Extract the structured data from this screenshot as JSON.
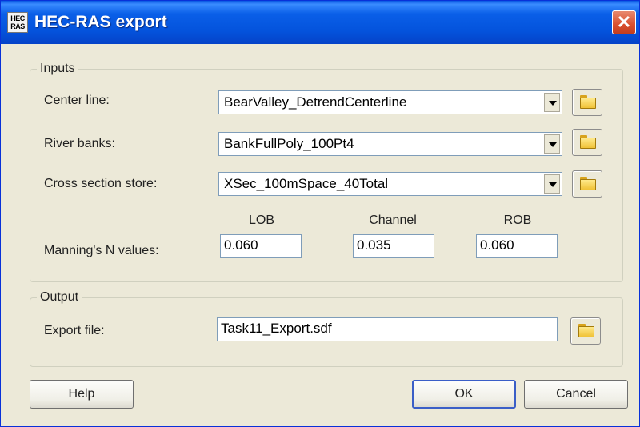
{
  "window": {
    "title": "HEC-RAS export",
    "app_icon_text_top": "HEC",
    "app_icon_text_bottom": "RAS",
    "close_glyph": "✕"
  },
  "inputs": {
    "group_label": "Inputs",
    "center_line": {
      "label": "Center line:",
      "value": "BearValley_DetrendCenterline"
    },
    "river_banks": {
      "label": "River banks:",
      "value": "BankFullPoly_100Pt4"
    },
    "cross_section_store": {
      "label": "Cross section store:",
      "value": "XSec_100mSpace_40Total"
    },
    "mannings": {
      "label": "Manning's N values:",
      "lob": {
        "header": "LOB",
        "value": "0.060"
      },
      "channel": {
        "header": "Channel",
        "value": "0.035"
      },
      "rob": {
        "header": "ROB",
        "value": "0.060"
      }
    }
  },
  "output": {
    "group_label": "Output",
    "export_file": {
      "label": "Export file:",
      "value": "Task11_Export.sdf"
    }
  },
  "buttons": {
    "help": "Help",
    "ok": "OK",
    "cancel": "Cancel"
  },
  "icons": {
    "browse": "folder-icon",
    "dropdown": "chevron-down-icon",
    "close": "close-icon"
  },
  "colors": {
    "titlebar": "#0453dc",
    "close": "#d9502f",
    "dialog_bg": "#ece9d8"
  }
}
